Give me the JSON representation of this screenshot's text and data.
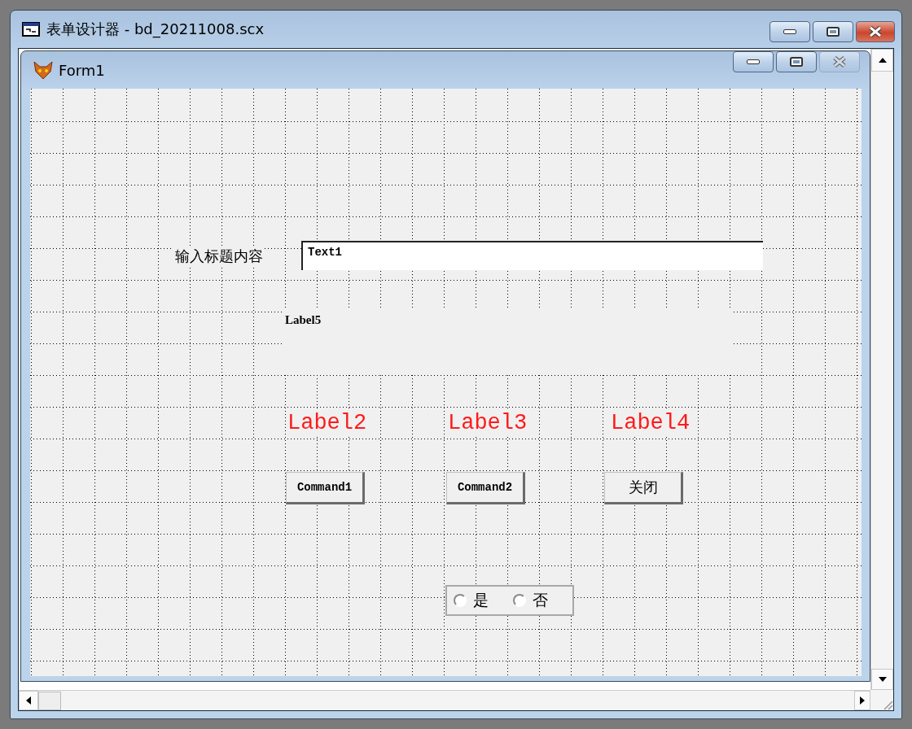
{
  "window": {
    "title": "表单设计器 - bd_20211008.scx"
  },
  "form": {
    "title": "Form1",
    "prompt_label": "输入标题内容",
    "text_box": {
      "value": "Text1"
    },
    "caption_label": "Label5",
    "labels": [
      "Label2",
      "Label3",
      "Label4"
    ],
    "buttons": [
      "Command1",
      "Command2",
      "关闭"
    ],
    "option_group": [
      {
        "label": "是",
        "selected": false
      },
      {
        "label": "否",
        "selected": false
      }
    ]
  }
}
